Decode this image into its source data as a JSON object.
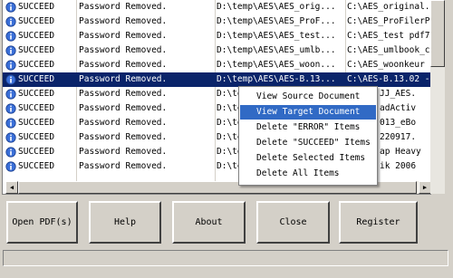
{
  "rows": [
    {
      "status": "SUCCEED",
      "message": "Password Removed.",
      "source": "D:\\temp\\AES\\AES_orig...",
      "target": "C:\\AES_original..."
    },
    {
      "status": "SUCCEED",
      "message": "Password Removed.",
      "source": "D:\\temp\\AES\\AES_ProF...",
      "target": "C:\\AES_ProFilerP"
    },
    {
      "status": "SUCCEED",
      "message": "Password Removed.",
      "source": "D:\\temp\\AES\\AES_test...",
      "target": "C:\\AES_test pdf7"
    },
    {
      "status": "SUCCEED",
      "message": "Password Removed.",
      "source": "D:\\temp\\AES\\AES_umlb...",
      "target": "C:\\AES_umlbook_c"
    },
    {
      "status": "SUCCEED",
      "message": "Password Removed.",
      "source": "D:\\temp\\AES\\AES_woon...",
      "target": "C:\\AES_woonkeur"
    },
    {
      "status": "SUCCEED",
      "message": "Password Removed.",
      "source": "D:\\temp\\AES\\AES-B.13...",
      "target": "C:\\AES-B.13.02 -"
    },
    {
      "status": "SUCCEED",
      "message": "Password Removed.",
      "source": "D:\\te",
      "target": "JJ_AES."
    },
    {
      "status": "SUCCEED",
      "message": "Password Removed.",
      "source": "D:\\te",
      "target": "adActiv"
    },
    {
      "status": "SUCCEED",
      "message": "Password Removed.",
      "source": "D:\\te",
      "target": "013_eBo"
    },
    {
      "status": "SUCCEED",
      "message": "Password Removed.",
      "source": "D:\\te",
      "target": "220917."
    },
    {
      "status": "SUCCEED",
      "message": "Password Removed.",
      "source": "D:\\te",
      "target": "ap Heavy"
    },
    {
      "status": "SUCCEED",
      "message": "Password Removed.",
      "source": "D:\\te",
      "target": "ik 2006"
    }
  ],
  "selected_row": 5,
  "context_menu": [
    {
      "label": "View Source Document"
    },
    {
      "label": "View Target Document"
    },
    {
      "label": "Delete \"ERROR\" Items"
    },
    {
      "label": "Delete \"SUCCEED\" Items"
    },
    {
      "label": "Delete Selected Items"
    },
    {
      "label": "Delete All Items"
    }
  ],
  "highlighted_menu_item": 1,
  "buttons": {
    "open": "Open PDF(s)",
    "help": "Help",
    "about": "About",
    "close": "Close",
    "register": "Register"
  },
  "colors": {
    "selection": "#0a246a",
    "menu_highlight": "#316ac5",
    "face": "#d4d0c8"
  },
  "icons": {
    "status": "info-icon"
  }
}
